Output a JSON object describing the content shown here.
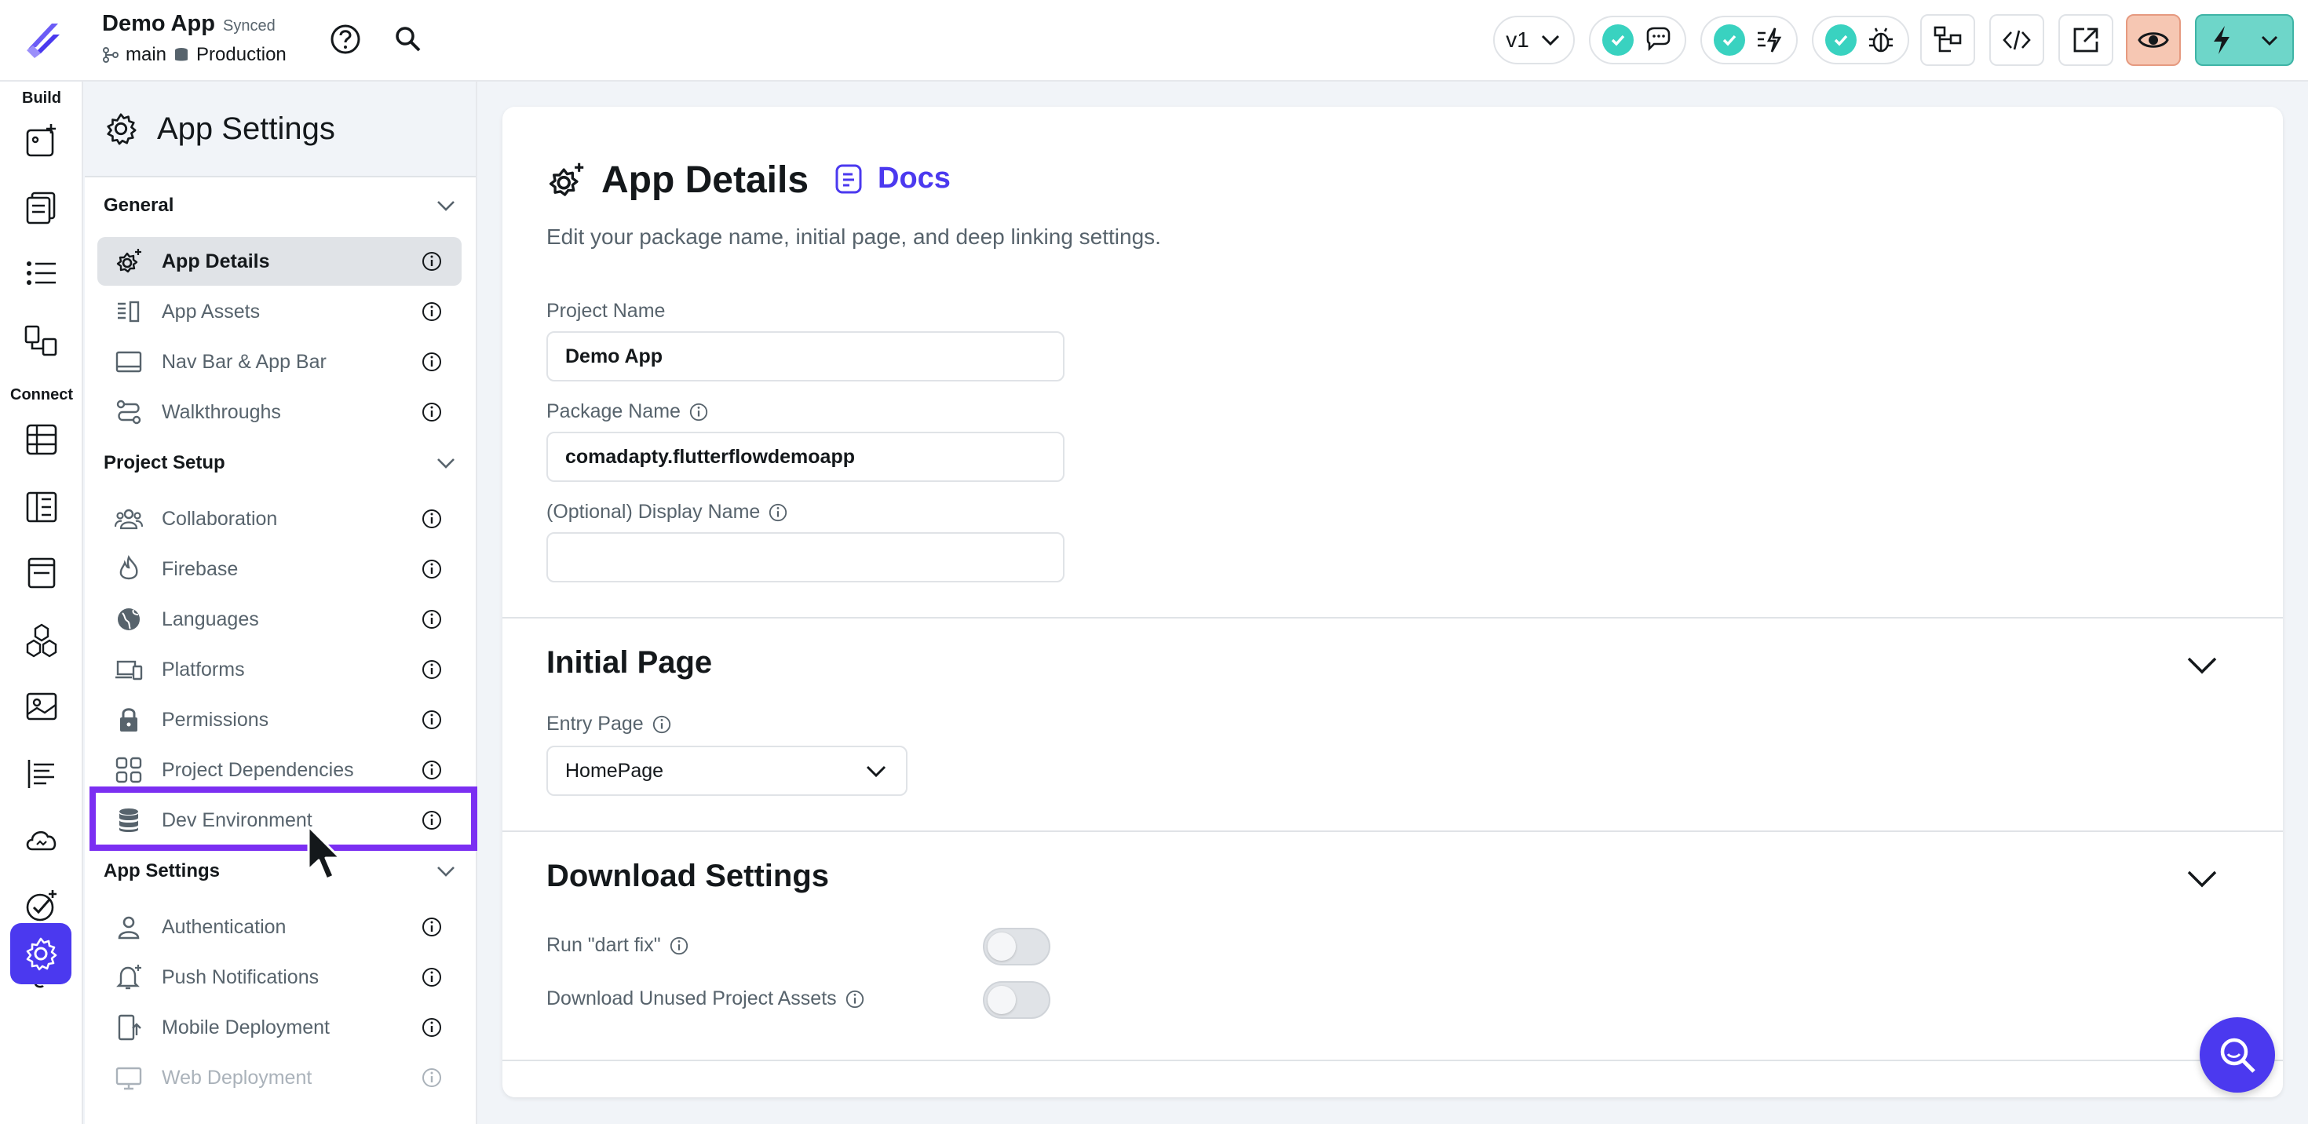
{
  "header": {
    "project_name": "Demo App",
    "sync_status": "Synced",
    "branch": "main",
    "environment": "Production",
    "version": "v1"
  },
  "rail": {
    "build_label": "Build",
    "connect_label": "Connect"
  },
  "panel": {
    "title": "App Settings",
    "sections": [
      {
        "title": "General",
        "items": [
          "App Details",
          "App Assets",
          "Nav Bar & App Bar",
          "Walkthroughs"
        ]
      },
      {
        "title": "Project Setup",
        "items": [
          "Collaboration",
          "Firebase",
          "Languages",
          "Platforms",
          "Permissions",
          "Project Dependencies",
          "Dev Environment"
        ]
      },
      {
        "title": "App Settings",
        "items": [
          "Authentication",
          "Push Notifications",
          "Mobile Deployment",
          "Web Deployment"
        ]
      }
    ]
  },
  "main": {
    "title": "App Details",
    "docs_label": "Docs",
    "subtitle": "Edit your package name, initial page, and deep linking settings.",
    "project_name_label": "Project Name",
    "project_name_value": "Demo App",
    "package_name_label": "Package Name",
    "package_name_value": "comadapty.flutterflowdemoapp",
    "display_name_label": "(Optional) Display Name",
    "display_name_value": "",
    "initial_page_title": "Initial Page",
    "entry_page_label": "Entry Page",
    "entry_page_value": "HomePage",
    "download_settings_title": "Download Settings",
    "dart_fix_label": "Run \"dart fix\"",
    "unused_assets_label": "Download Unused Project Assets"
  },
  "colors": {
    "accent": "#4b39ef",
    "highlight": "#7b2ff2",
    "success": "#39d2c0",
    "preview_button": "#f6c7b3",
    "run_button": "#6ed6c9"
  }
}
